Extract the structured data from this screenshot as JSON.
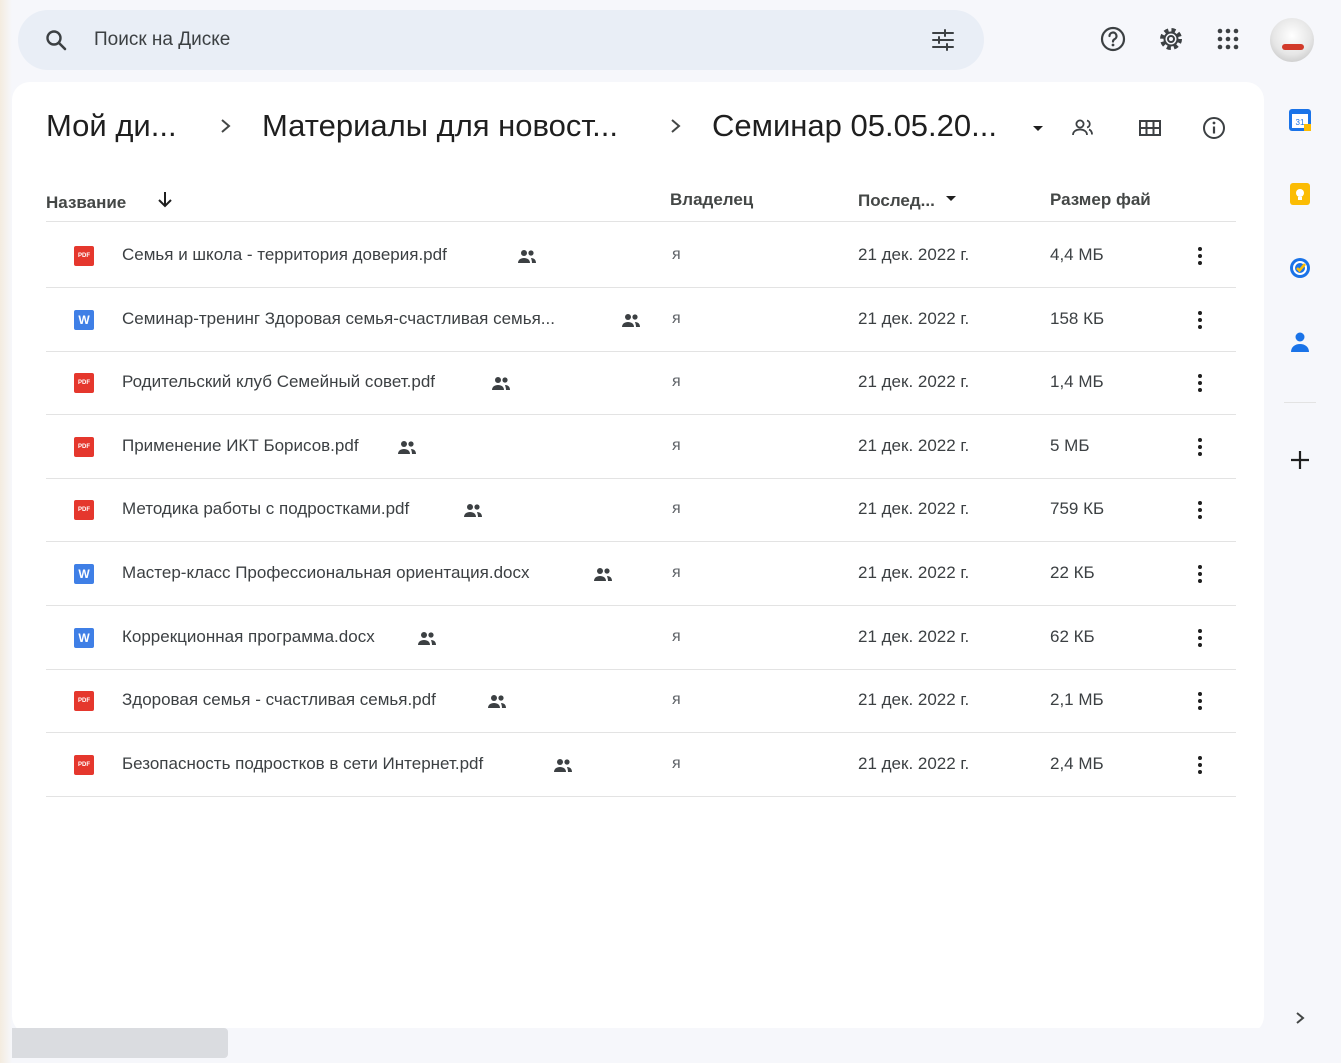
{
  "search": {
    "placeholder": "Поиск на Диске"
  },
  "breadcrumbs": {
    "items": [
      "Мой ди...",
      "Материалы для новост...",
      "Семинар 05.05.20..."
    ]
  },
  "table": {
    "headers": {
      "name": "Название",
      "owner": "Владелец",
      "modified": "Послед...",
      "size": "Размер фай"
    },
    "rows": [
      {
        "type": "pdf",
        "name": "Семья и школа - территория доверия.pdf",
        "owner": "я",
        "date": "21 дек. 2022 г.",
        "size": "4,4 МБ"
      },
      {
        "type": "word",
        "name": "Семинар-тренинг Здоровая семья-счастливая семья...",
        "owner": "я",
        "date": "21 дек. 2022 г.",
        "size": "158 КБ"
      },
      {
        "type": "pdf",
        "name": "Родительский клуб Семейный совет.pdf",
        "owner": "я",
        "date": "21 дек. 2022 г.",
        "size": "1,4 МБ"
      },
      {
        "type": "pdf",
        "name": "Применение ИКТ Борисов.pdf",
        "owner": "я",
        "date": "21 дек. 2022 г.",
        "size": "5 МБ"
      },
      {
        "type": "pdf",
        "name": "Методика работы с подростками.pdf",
        "owner": "я",
        "date": "21 дек. 2022 г.",
        "size": "759 КБ"
      },
      {
        "type": "word",
        "name": "Мастер-класс Профессиональная ориентация.docx",
        "owner": "я",
        "date": "21 дек. 2022 г.",
        "size": "22 КБ"
      },
      {
        "type": "word",
        "name": "Коррекционная программа.docx",
        "owner": "я",
        "date": "21 дек. 2022 г.",
        "size": "62 КБ"
      },
      {
        "type": "pdf",
        "name": "Здоровая семья - счастливая семья.pdf",
        "owner": "я",
        "date": "21 дек. 2022 г.",
        "size": "2,1 МБ"
      },
      {
        "type": "pdf",
        "name": "Безопасность подростков в сети Интернет.pdf",
        "owner": "я",
        "date": "21 дек. 2022 г.",
        "size": "2,4 МБ"
      }
    ]
  },
  "file_type_badges": {
    "pdf": "PDF",
    "word": "W"
  },
  "colors": {
    "accent": "#0b57d0",
    "pdf": "#e5372d",
    "word": "#3f7fe6",
    "keep": "#fbbc04",
    "tasks": "#1a73e8"
  },
  "side_panel": {
    "icons": [
      "calendar-icon",
      "keep-icon",
      "tasks-icon",
      "contacts-icon",
      "add-icon"
    ]
  }
}
